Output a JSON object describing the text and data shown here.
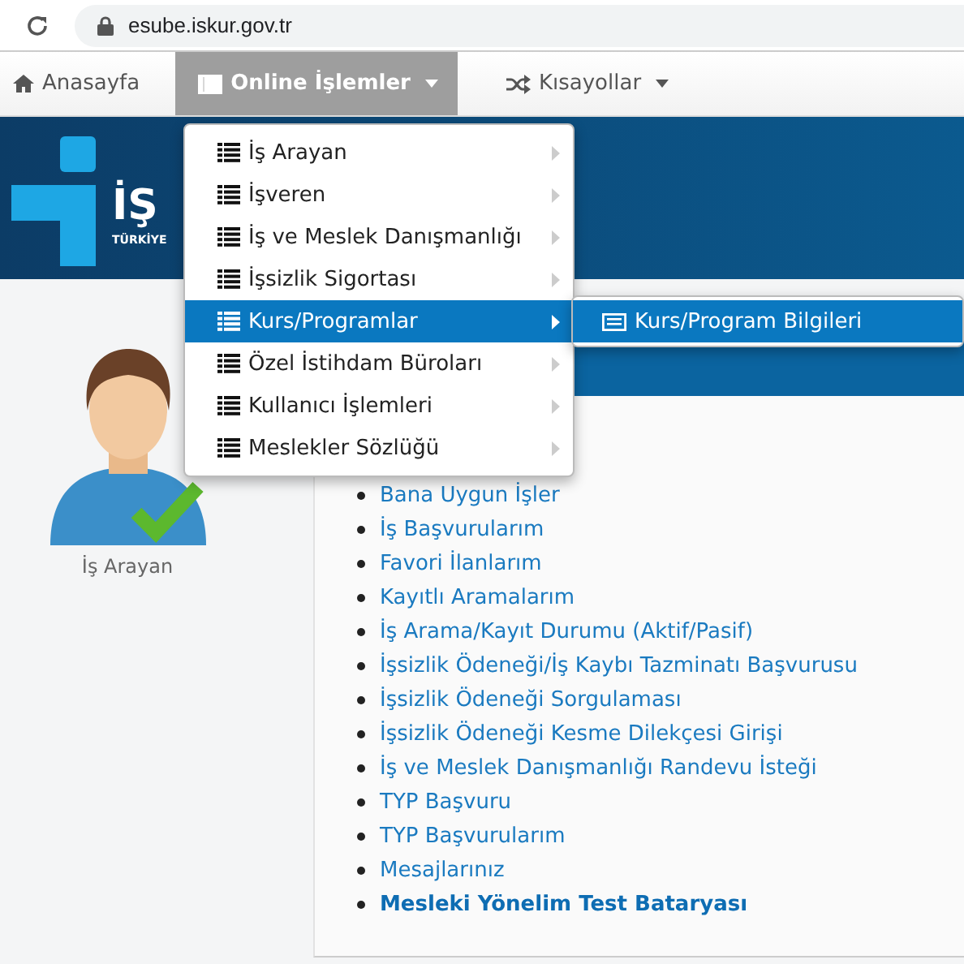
{
  "browser": {
    "url": "esube.iskur.gov.tr"
  },
  "nav": [
    {
      "label": "Anasayfa",
      "selected": false,
      "dropdown": false
    },
    {
      "label": "Online İşlemler",
      "selected": true,
      "dropdown": true
    },
    {
      "label": "Kısayollar",
      "selected": false,
      "dropdown": true
    }
  ],
  "banner": {
    "logo_text": "İŞ",
    "logo_subtitle": "TÜRKİYE"
  },
  "menu": {
    "items": [
      {
        "label": "İş Arayan",
        "selected": false
      },
      {
        "label": "İşveren",
        "selected": false
      },
      {
        "label": "İş ve Meslek Danışmanlığı",
        "selected": false
      },
      {
        "label": "İşsizlik Sigortası",
        "selected": false
      },
      {
        "label": "Kurs/Programlar",
        "selected": true
      },
      {
        "label": "Özel İstihdam Büroları",
        "selected": false
      },
      {
        "label": "Kullanıcı İşlemleri",
        "selected": false
      },
      {
        "label": "Meslekler Sözlüğü",
        "selected": false
      }
    ],
    "submenu": [
      {
        "label": "Kurs/Program Bilgileri",
        "selected": true
      }
    ]
  },
  "profile": {
    "caption": "İş Arayan"
  },
  "links": [
    {
      "label": "Bana Uygun İşler",
      "bold": false
    },
    {
      "label": "İş Başvurularım",
      "bold": false
    },
    {
      "label": "Favori İlanlarım",
      "bold": false
    },
    {
      "label": "Kayıtlı Aramalarım",
      "bold": false
    },
    {
      "label": "İş Arama/Kayıt Durumu (Aktif/Pasif)",
      "bold": false
    },
    {
      "label": "İşsizlik Ödeneği/İş Kaybı Tazminatı Başvurusu",
      "bold": false
    },
    {
      "label": "İşsizlik Ödeneği Sorgulaması",
      "bold": false
    },
    {
      "label": "İşsizlik Ödeneği Kesme Dilekçesi Girişi",
      "bold": false
    },
    {
      "label": "İş ve Meslek Danışmanlığı Randevu İsteği",
      "bold": false
    },
    {
      "label": "TYP Başvuru",
      "bold": false
    },
    {
      "label": "TYP Başvurularım",
      "bold": false
    },
    {
      "label": "Mesajlarınız",
      "bold": false
    },
    {
      "label": "Mesleki Yönelim Test Bataryası",
      "bold": true
    }
  ]
}
